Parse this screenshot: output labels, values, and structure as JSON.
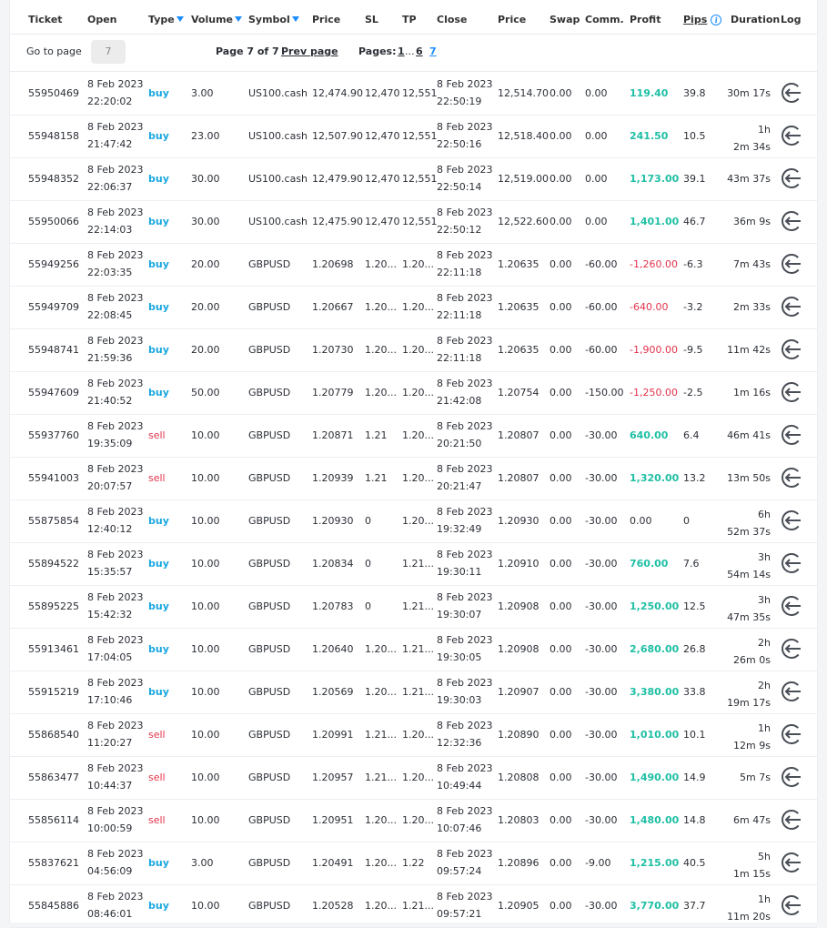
{
  "header": {
    "ticket": "Ticket",
    "open": "Open",
    "type": "Type",
    "volume": "Volume",
    "symbol": "Symbol",
    "price": "Price",
    "sl": "SL",
    "tp": "TP",
    "close": "Close",
    "close_price": "Price",
    "swap": "Swap",
    "comm": "Comm.",
    "profit": "Profit",
    "pips": "Pips",
    "duration": "Duration",
    "log": "Log"
  },
  "pager": {
    "go_to_label": "Go to page",
    "page_input_placeholder": "7",
    "page_info": "Page 7 of 7",
    "prev_label": "Prev page",
    "pages_label": "Pages:",
    "page_first": "1",
    "ellipsis": "...",
    "page_prev": "6",
    "page_current": "7"
  },
  "rows": [
    {
      "ticket": "55950469",
      "open_date": "8 Feb 2023",
      "open_time": "22:20:02",
      "type": "buy",
      "volume": "3.00",
      "symbol": "US100.cash",
      "price": "12,474.90",
      "sl": "12,470",
      "tp": "12,551",
      "close_date": "8 Feb 2023",
      "close_time": "22:50:19",
      "close_price": "12,514.70",
      "swap": "0.00",
      "comm": "0.00",
      "profit": "119.40",
      "pips": "39.8",
      "dur1": "30m 17s",
      "dur2": ""
    },
    {
      "ticket": "55948158",
      "open_date": "8 Feb 2023",
      "open_time": "21:47:42",
      "type": "buy",
      "volume": "23.00",
      "symbol": "US100.cash",
      "price": "12,507.90",
      "sl": "12,470",
      "tp": "12,551",
      "close_date": "8 Feb 2023",
      "close_time": "22:50:16",
      "close_price": "12,518.40",
      "swap": "0.00",
      "comm": "0.00",
      "profit": "241.50",
      "pips": "10.5",
      "dur1": "1h",
      "dur2": "2m 34s"
    },
    {
      "ticket": "55948352",
      "open_date": "8 Feb 2023",
      "open_time": "22:06:37",
      "type": "buy",
      "volume": "30.00",
      "symbol": "US100.cash",
      "price": "12,479.90",
      "sl": "12,470",
      "tp": "12,551",
      "close_date": "8 Feb 2023",
      "close_time": "22:50:14",
      "close_price": "12,519.00",
      "swap": "0.00",
      "comm": "0.00",
      "profit": "1,173.00",
      "pips": "39.1",
      "dur1": "43m 37s",
      "dur2": ""
    },
    {
      "ticket": "55950066",
      "open_date": "8 Feb 2023",
      "open_time": "22:14:03",
      "type": "buy",
      "volume": "30.00",
      "symbol": "US100.cash",
      "price": "12,475.90",
      "sl": "12,470",
      "tp": "12,551",
      "close_date": "8 Feb 2023",
      "close_time": "22:50:12",
      "close_price": "12,522.60",
      "swap": "0.00",
      "comm": "0.00",
      "profit": "1,401.00",
      "pips": "46.7",
      "dur1": "36m 9s",
      "dur2": ""
    },
    {
      "ticket": "55949256",
      "open_date": "8 Feb 2023",
      "open_time": "22:03:35",
      "type": "buy",
      "volume": "20.00",
      "symbol": "GBPUSD",
      "price": "1.20698",
      "sl": "1.20...",
      "tp": "1.20...",
      "close_date": "8 Feb 2023",
      "close_time": "22:11:18",
      "close_price": "1.20635",
      "swap": "0.00",
      "comm": "-60.00",
      "profit": "-1,260.00",
      "pips": "-6.3",
      "dur1": "7m 43s",
      "dur2": ""
    },
    {
      "ticket": "55949709",
      "open_date": "8 Feb 2023",
      "open_time": "22:08:45",
      "type": "buy",
      "volume": "20.00",
      "symbol": "GBPUSD",
      "price": "1.20667",
      "sl": "1.20...",
      "tp": "1.20...",
      "close_date": "8 Feb 2023",
      "close_time": "22:11:18",
      "close_price": "1.20635",
      "swap": "0.00",
      "comm": "-60.00",
      "profit": "-640.00",
      "pips": "-3.2",
      "dur1": "2m 33s",
      "dur2": ""
    },
    {
      "ticket": "55948741",
      "open_date": "8 Feb 2023",
      "open_time": "21:59:36",
      "type": "buy",
      "volume": "20.00",
      "symbol": "GBPUSD",
      "price": "1.20730",
      "sl": "1.20...",
      "tp": "1.20...",
      "close_date": "8 Feb 2023",
      "close_time": "22:11:18",
      "close_price": "1.20635",
      "swap": "0.00",
      "comm": "-60.00",
      "profit": "-1,900.00",
      "pips": "-9.5",
      "dur1": "11m 42s",
      "dur2": ""
    },
    {
      "ticket": "55947609",
      "open_date": "8 Feb 2023",
      "open_time": "21:40:52",
      "type": "buy",
      "volume": "50.00",
      "symbol": "GBPUSD",
      "price": "1.20779",
      "sl": "1.20...",
      "tp": "1.20...",
      "close_date": "8 Feb 2023",
      "close_time": "21:42:08",
      "close_price": "1.20754",
      "swap": "0.00",
      "comm": "-150.00",
      "profit": "-1,250.00",
      "pips": "-2.5",
      "dur1": "1m 16s",
      "dur2": ""
    },
    {
      "ticket": "55937760",
      "open_date": "8 Feb 2023",
      "open_time": "19:35:09",
      "type": "sell",
      "volume": "10.00",
      "symbol": "GBPUSD",
      "price": "1.20871",
      "sl": "1.21",
      "tp": "1.20...",
      "close_date": "8 Feb 2023",
      "close_time": "20:21:50",
      "close_price": "1.20807",
      "swap": "0.00",
      "comm": "-30.00",
      "profit": "640.00",
      "pips": "6.4",
      "dur1": "46m 41s",
      "dur2": ""
    },
    {
      "ticket": "55941003",
      "open_date": "8 Feb 2023",
      "open_time": "20:07:57",
      "type": "sell",
      "volume": "10.00",
      "symbol": "GBPUSD",
      "price": "1.20939",
      "sl": "1.21",
      "tp": "1.20...",
      "close_date": "8 Feb 2023",
      "close_time": "20:21:47",
      "close_price": "1.20807",
      "swap": "0.00",
      "comm": "-30.00",
      "profit": "1,320.00",
      "pips": "13.2",
      "dur1": "13m 50s",
      "dur2": ""
    },
    {
      "ticket": "55875854",
      "open_date": "8 Feb 2023",
      "open_time": "12:40:12",
      "type": "buy",
      "volume": "10.00",
      "symbol": "GBPUSD",
      "price": "1.20930",
      "sl": "0",
      "tp": "1.20...",
      "close_date": "8 Feb 2023",
      "close_time": "19:32:49",
      "close_price": "1.20930",
      "swap": "0.00",
      "comm": "-30.00",
      "profit": "0.00",
      "pips": "0",
      "dur1": "6h",
      "dur2": "52m 37s"
    },
    {
      "ticket": "55894522",
      "open_date": "8 Feb 2023",
      "open_time": "15:35:57",
      "type": "buy",
      "volume": "10.00",
      "symbol": "GBPUSD",
      "price": "1.20834",
      "sl": "0",
      "tp": "1.21...",
      "close_date": "8 Feb 2023",
      "close_time": "19:30:11",
      "close_price": "1.20910",
      "swap": "0.00",
      "comm": "-30.00",
      "profit": "760.00",
      "pips": "7.6",
      "dur1": "3h",
      "dur2": "54m 14s"
    },
    {
      "ticket": "55895225",
      "open_date": "8 Feb 2023",
      "open_time": "15:42:32",
      "type": "buy",
      "volume": "10.00",
      "symbol": "GBPUSD",
      "price": "1.20783",
      "sl": "0",
      "tp": "1.21...",
      "close_date": "8 Feb 2023",
      "close_time": "19:30:07",
      "close_price": "1.20908",
      "swap": "0.00",
      "comm": "-30.00",
      "profit": "1,250.00",
      "pips": "12.5",
      "dur1": "3h",
      "dur2": "47m 35s"
    },
    {
      "ticket": "55913461",
      "open_date": "8 Feb 2023",
      "open_time": "17:04:05",
      "type": "buy",
      "volume": "10.00",
      "symbol": "GBPUSD",
      "price": "1.20640",
      "sl": "1.20...",
      "tp": "1.21...",
      "close_date": "8 Feb 2023",
      "close_time": "19:30:05",
      "close_price": "1.20908",
      "swap": "0.00",
      "comm": "-30.00",
      "profit": "2,680.00",
      "pips": "26.8",
      "dur1": "2h",
      "dur2": "26m 0s"
    },
    {
      "ticket": "55915219",
      "open_date": "8 Feb 2023",
      "open_time": "17:10:46",
      "type": "buy",
      "volume": "10.00",
      "symbol": "GBPUSD",
      "price": "1.20569",
      "sl": "1.20...",
      "tp": "1.21...",
      "close_date": "8 Feb 2023",
      "close_time": "19:30:03",
      "close_price": "1.20907",
      "swap": "0.00",
      "comm": "-30.00",
      "profit": "3,380.00",
      "pips": "33.8",
      "dur1": "2h",
      "dur2": "19m 17s"
    },
    {
      "ticket": "55868540",
      "open_date": "8 Feb 2023",
      "open_time": "11:20:27",
      "type": "sell",
      "volume": "10.00",
      "symbol": "GBPUSD",
      "price": "1.20991",
      "sl": "1.21...",
      "tp": "1.20...",
      "close_date": "8 Feb 2023",
      "close_time": "12:32:36",
      "close_price": "1.20890",
      "swap": "0.00",
      "comm": "-30.00",
      "profit": "1,010.00",
      "pips": "10.1",
      "dur1": "1h",
      "dur2": "12m 9s"
    },
    {
      "ticket": "55863477",
      "open_date": "8 Feb 2023",
      "open_time": "10:44:37",
      "type": "sell",
      "volume": "10.00",
      "symbol": "GBPUSD",
      "price": "1.20957",
      "sl": "1.21...",
      "tp": "1.20...",
      "close_date": "8 Feb 2023",
      "close_time": "10:49:44",
      "close_price": "1.20808",
      "swap": "0.00",
      "comm": "-30.00",
      "profit": "1,490.00",
      "pips": "14.9",
      "dur1": "5m 7s",
      "dur2": ""
    },
    {
      "ticket": "55856114",
      "open_date": "8 Feb 2023",
      "open_time": "10:00:59",
      "type": "sell",
      "volume": "10.00",
      "symbol": "GBPUSD",
      "price": "1.20951",
      "sl": "1.20...",
      "tp": "1.20...",
      "close_date": "8 Feb 2023",
      "close_time": "10:07:46",
      "close_price": "1.20803",
      "swap": "0.00",
      "comm": "-30.00",
      "profit": "1,480.00",
      "pips": "14.8",
      "dur1": "6m 47s",
      "dur2": ""
    },
    {
      "ticket": "55837621",
      "open_date": "8 Feb 2023",
      "open_time": "04:56:09",
      "type": "buy",
      "volume": "3.00",
      "symbol": "GBPUSD",
      "price": "1.20491",
      "sl": "1.20...",
      "tp": "1.22",
      "close_date": "8 Feb 2023",
      "close_time": "09:57:24",
      "close_price": "1.20896",
      "swap": "0.00",
      "comm": "-9.00",
      "profit": "1,215.00",
      "pips": "40.5",
      "dur1": "5h",
      "dur2": "1m 15s"
    },
    {
      "ticket": "55845886",
      "open_date": "8 Feb 2023",
      "open_time": "08:46:01",
      "type": "buy",
      "volume": "10.00",
      "symbol": "GBPUSD",
      "price": "1.20528",
      "sl": "1.20...",
      "tp": "1.21...",
      "close_date": "8 Feb 2023",
      "close_time": "09:57:21",
      "close_price": "1.20905",
      "swap": "0.00",
      "comm": "-30.00",
      "profit": "3,770.00",
      "pips": "37.7",
      "dur1": "1h",
      "dur2": "11m 20s"
    }
  ],
  "colors": {
    "buy": "#19a7e0",
    "sell": "#e2334b",
    "profit_positive": "#1fbfa5",
    "profit_negative": "#e2334b",
    "accent": "#1a8cff"
  }
}
